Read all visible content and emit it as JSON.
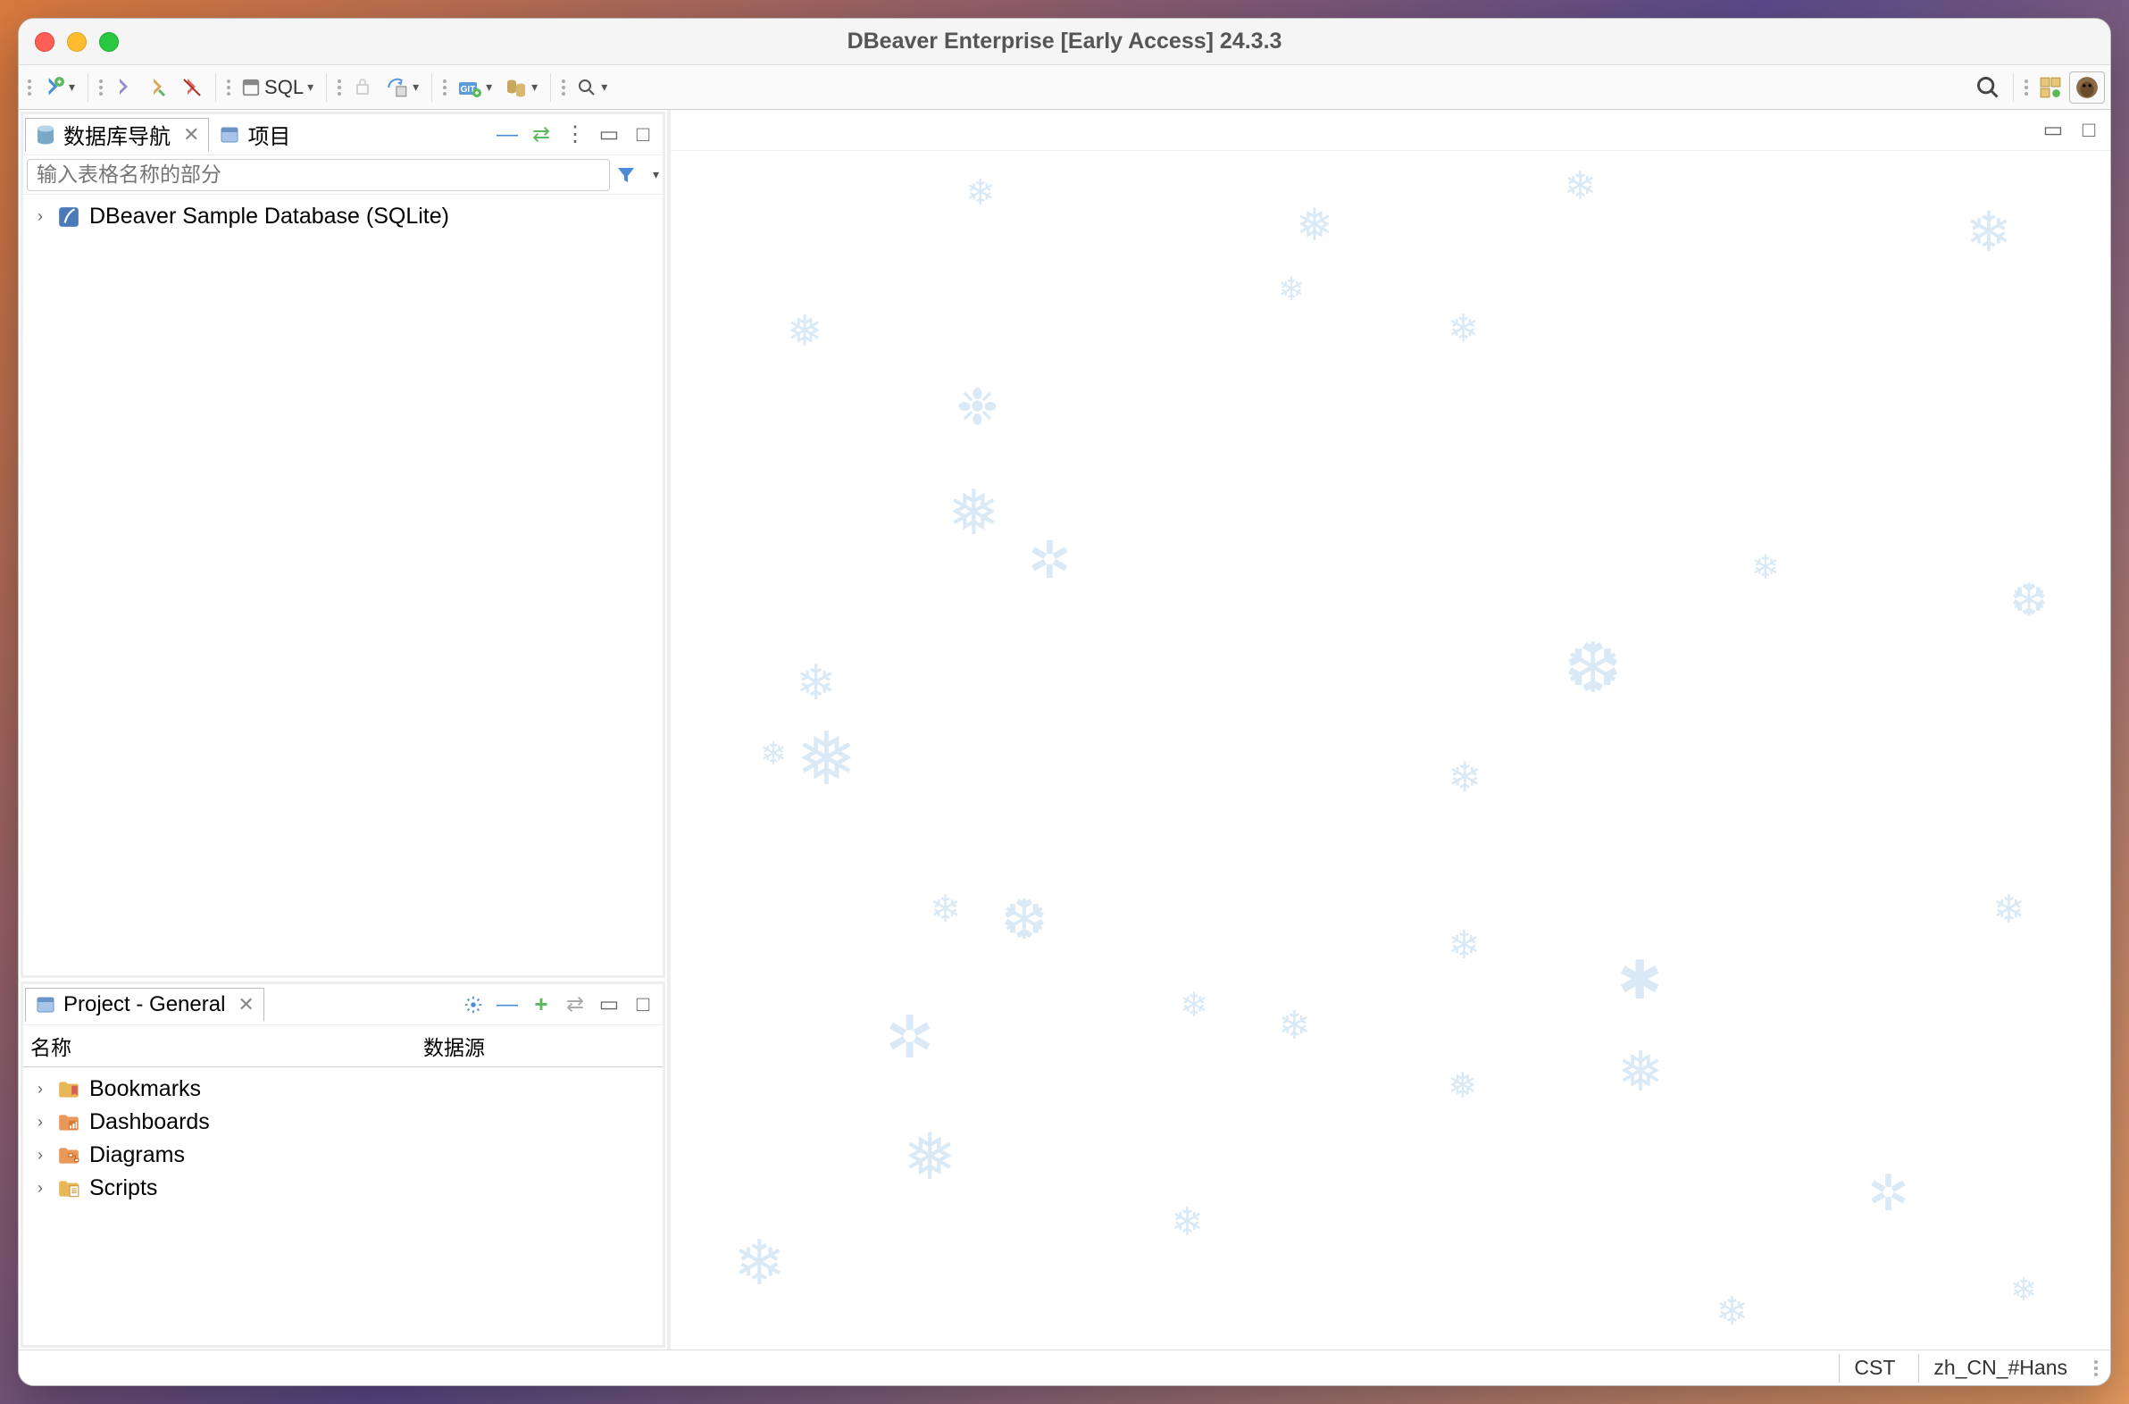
{
  "window": {
    "title": "DBeaver Enterprise [Early Access] 24.3.3"
  },
  "toolbar": {
    "sql_label": "SQL"
  },
  "nav_panel": {
    "tab1_label": "数据库导航",
    "tab2_label": "项目",
    "search_placeholder": "输入表格名称的部分",
    "tree_item_label": "DBeaver Sample Database (SQLite)"
  },
  "project_panel": {
    "tab_label": "Project - General",
    "col_name": "名称",
    "col_ds": "数据源",
    "items": [
      {
        "label": "Bookmarks"
      },
      {
        "label": "Dashboards"
      },
      {
        "label": "Diagrams"
      },
      {
        "label": "Scripts"
      }
    ]
  },
  "status": {
    "tz": "CST",
    "locale": "zh_CN_#Hans"
  }
}
